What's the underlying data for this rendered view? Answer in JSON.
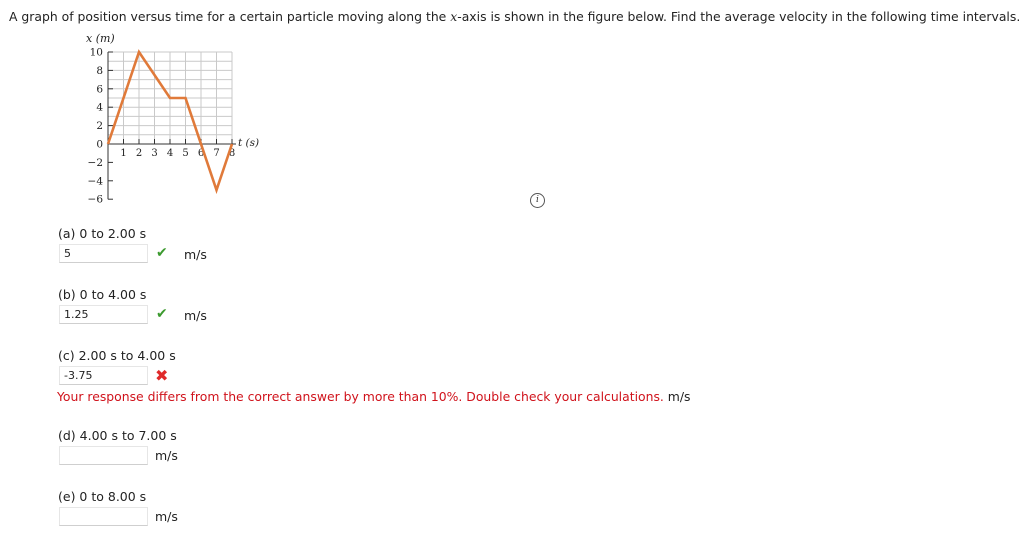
{
  "question": {
    "text_before": "A graph of position versus time for a certain particle moving along the ",
    "axis_var": "x",
    "text_after": "-axis is shown in the figure below. Find the average velocity in the following time intervals."
  },
  "chart_data": {
    "type": "line",
    "ylabel": "x (m)",
    "xlabel": "t (s)",
    "ylim": [
      -6,
      10
    ],
    "xlim": [
      0,
      8
    ],
    "y_ticks": [
      "10",
      "8",
      "6",
      "4",
      "2",
      "0",
      "-2",
      "-4",
      "-6"
    ],
    "x_ticks": [
      "1",
      "2",
      "3",
      "4",
      "5",
      "6",
      "7",
      "8"
    ],
    "grid": true,
    "line_color": "#e07a3a",
    "x": [
      0,
      2,
      4,
      5,
      7,
      8
    ],
    "y": [
      0,
      10,
      5,
      5,
      -5,
      0
    ]
  },
  "info_icon": "info-icon",
  "parts": [
    {
      "label": "(a) 0 to 2.00 s",
      "value": "5",
      "unit": "m/s",
      "status": "correct"
    },
    {
      "label": "(b) 0 to 4.00 s",
      "value": "1.25",
      "unit": "m/s",
      "status": "correct"
    },
    {
      "label": "(c) 2.00 s to 4.00 s",
      "value": "-3.75",
      "unit": "m/s",
      "status": "incorrect",
      "feedback": "Your response differs from the correct answer by more than 10%. Double check your calculations."
    },
    {
      "label": "(d) 4.00 s to 7.00 s",
      "value": "",
      "unit": "m/s",
      "status": "none"
    },
    {
      "label": "(e) 0 to 8.00 s",
      "value": "",
      "unit": "m/s",
      "status": "none"
    }
  ],
  "marks": {
    "correct": "✔",
    "incorrect": "✖"
  },
  "colors": {
    "correct": "#3c9a2f",
    "incorrect": "#e02a2a",
    "feedback": "#d0121b"
  }
}
